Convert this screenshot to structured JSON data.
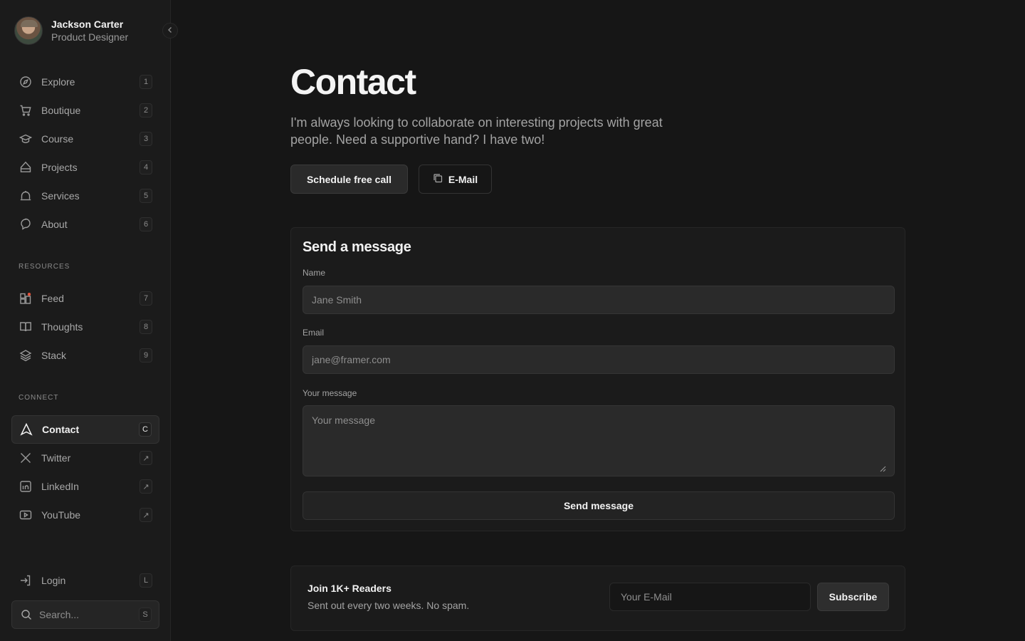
{
  "profile": {
    "name": "Jackson Carter",
    "role": "Product Designer"
  },
  "nav": {
    "main": [
      {
        "label": "Explore",
        "key": "1",
        "icon": "compass-icon"
      },
      {
        "label": "Boutique",
        "key": "2",
        "icon": "cart-icon"
      },
      {
        "label": "Course",
        "key": "3",
        "icon": "graduation-cap-icon"
      },
      {
        "label": "Projects",
        "key": "4",
        "icon": "projects-icon"
      },
      {
        "label": "Services",
        "key": "5",
        "icon": "bell-icon"
      },
      {
        "label": "About",
        "key": "6",
        "icon": "speech-bubble-icon"
      }
    ],
    "resources_title": "RESOURCES",
    "resources": [
      {
        "label": "Feed",
        "key": "7",
        "icon": "feed-icon"
      },
      {
        "label": "Thoughts",
        "key": "8",
        "icon": "book-icon"
      },
      {
        "label": "Stack",
        "key": "9",
        "icon": "layers-icon"
      }
    ],
    "connect_title": "CONNECT",
    "connect": [
      {
        "label": "Contact",
        "key": "C",
        "icon": "navigation-arrow-icon",
        "active": true
      },
      {
        "label": "Twitter",
        "key": "↗",
        "icon": "x-logo-icon"
      },
      {
        "label": "LinkedIn",
        "key": "↗",
        "icon": "linkedin-icon"
      },
      {
        "label": "YouTube",
        "key": "↗",
        "icon": "youtube-icon"
      }
    ],
    "login": {
      "label": "Login",
      "key": "L",
      "icon": "login-arrow-icon"
    }
  },
  "search": {
    "placeholder": "Search...",
    "key": "S"
  },
  "page": {
    "title": "Contact",
    "intro": "I'm always looking to collaborate on interesting projects with great people. Need a supportive hand? I have two!",
    "schedule_label": "Schedule free call",
    "email_label": "E-Mail"
  },
  "form": {
    "title": "Send a message",
    "name_label": "Name",
    "name_placeholder": "Jane Smith",
    "email_label": "Email",
    "email_placeholder": "jane@framer.com",
    "message_label": "Your message",
    "message_placeholder": "Your message",
    "submit_label": "Send message"
  },
  "newsletter": {
    "title": "Join 1K+ Readers",
    "subtitle": "Sent out every two weeks. No spam.",
    "email_placeholder": "Your E-Mail",
    "subscribe_label": "Subscribe"
  },
  "colors": {
    "background": "#161616",
    "sidebar": "#1b1b1b",
    "notification_dot": "#e5533d"
  }
}
